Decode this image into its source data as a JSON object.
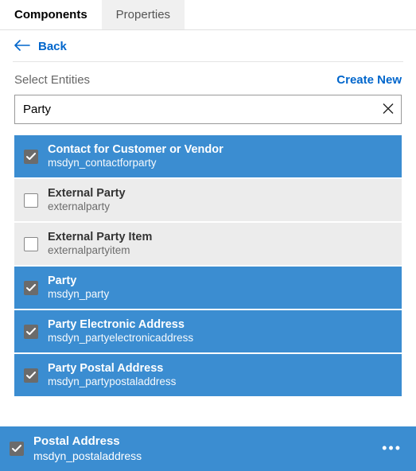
{
  "tabs": {
    "components": "Components",
    "properties": "Properties"
  },
  "back_label": "Back",
  "select_entities_label": "Select Entities",
  "create_new_label": "Create New",
  "search": {
    "value": "Party",
    "placeholder": ""
  },
  "entities": [
    {
      "title": "Contact for Customer or Vendor",
      "name": "msdyn_contactforparty",
      "selected": true
    },
    {
      "title": "External Party",
      "name": "externalparty",
      "selected": false
    },
    {
      "title": "External Party Item",
      "name": "externalpartyitem",
      "selected": false
    },
    {
      "title": "Party",
      "name": "msdyn_party",
      "selected": true
    },
    {
      "title": "Party Electronic Address",
      "name": "msdyn_partyelectronicaddress",
      "selected": true
    },
    {
      "title": "Party Postal Address",
      "name": "msdyn_partypostaladdress",
      "selected": true
    }
  ],
  "footer": {
    "title": "Postal Address",
    "name": "msdyn_postaladdress",
    "selected": true
  },
  "colors": {
    "accent": "#3b8dd1",
    "link": "#0066cc"
  }
}
